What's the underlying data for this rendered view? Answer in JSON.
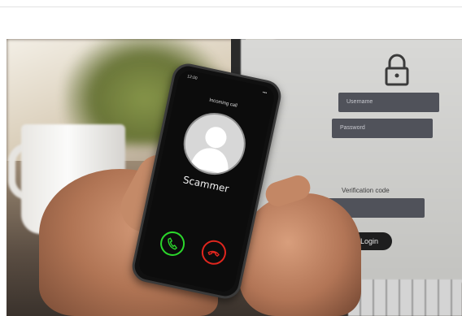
{
  "photo": {
    "phone": {
      "status_time": "12:00",
      "status_icons": "▪▪▪",
      "incoming_label": "Incoming call",
      "caller_name": "Scammer",
      "accept_icon": "phone-accept-icon",
      "decline_icon": "phone-decline-icon"
    },
    "laptop": {
      "username_placeholder": "Username",
      "password_placeholder": "Password",
      "verification_label": "Verification code",
      "login_label": "Login",
      "lock_icon": "padlock-icon"
    },
    "colors": {
      "accept": "#2bd62b",
      "decline": "#e0261e"
    }
  }
}
